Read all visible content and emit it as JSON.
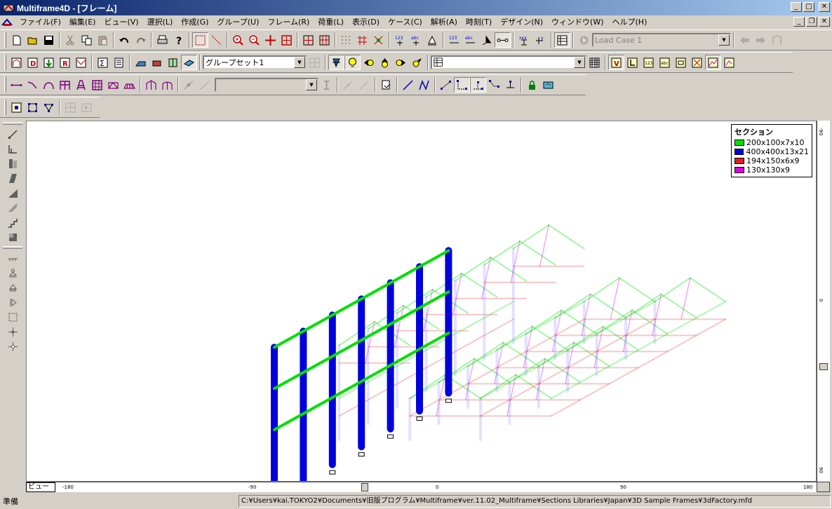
{
  "window": {
    "title": "Multiframe4D - [フレーム]"
  },
  "menu": [
    "ファイル(F)",
    "編集(E)",
    "ビュー(V)",
    "選択(L)",
    "作成(G)",
    "グループ(U)",
    "フレーム(R)",
    "荷重(L)",
    "表示(D)",
    "ケース(C)",
    "解析(A)",
    "時刻(T)",
    "デザイン(N)",
    "ウィンドウ(W)",
    "ヘルプ(H)"
  ],
  "toolbar": {
    "load_case": "Load Case 1",
    "group_set": "グループセット1",
    "group_label": "",
    "section_combo": ""
  },
  "legend": {
    "title": "セクション",
    "items": [
      {
        "label": "200x100x7x10",
        "color": "#00e000"
      },
      {
        "label": "400x400x13x21",
        "color": "#0000dd"
      },
      {
        "label": "194x150x6x9",
        "color": "#e02020"
      },
      {
        "label": "130x130x9",
        "color": "#e000e0"
      }
    ]
  },
  "rulers": {
    "horizontal": [
      "-180",
      "-90",
      "0",
      "90",
      "180"
    ],
    "vertical": [
      "-90",
      "0",
      "90"
    ]
  },
  "view_tab": "ビュー",
  "status": {
    "left": "準備",
    "path": "C:¥Users¥kai.TOKYO2¥Documents¥旧版プログラム¥Multiframe¥ver.11.02_Multiframe¥Sections Libraries¥Japan¥3D Sample Frames¥3dFactory.mfd"
  }
}
